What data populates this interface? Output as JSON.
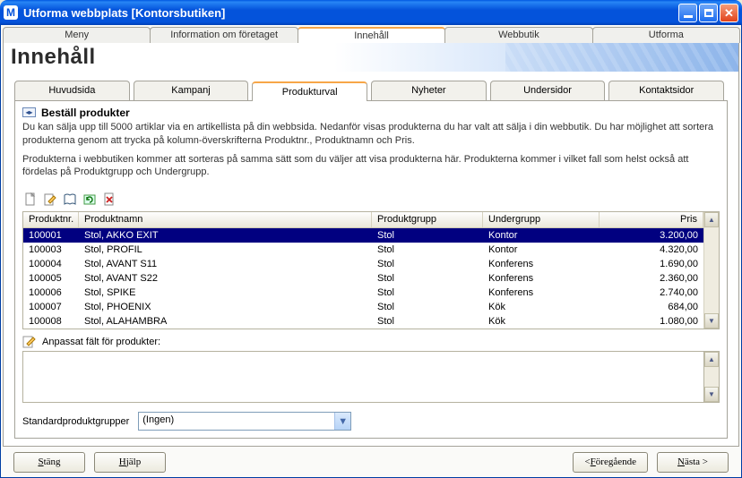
{
  "window": {
    "title": "Utforma webbplats [Kontorsbutiken]",
    "app_icon_letter": "M"
  },
  "main_tabs": {
    "items": [
      "Meny",
      "Information om företaget",
      "Innehåll",
      "Webbutik",
      "Utforma"
    ],
    "active_index": 2
  },
  "banner": {
    "heading": "Innehåll"
  },
  "sub_tabs": {
    "items": [
      "Huvudsida",
      "Kampanj",
      "Produkturval",
      "Nyheter",
      "Undersidor",
      "Kontaktsidor"
    ],
    "active_index": 2
  },
  "section": {
    "title": "Beställ produkter",
    "para1": "Du kan sälja upp till 5000 artiklar via en artikellista på din webbsida. Nedanför visas produkterna du har valt att sälja i din webbutik. Du har möjlighet att sortera produkterna genom att trycka på kolumn-överskrifterna Produktnr., Produktnamn och Pris.",
    "para2": "Produkterna i webbutiken kommer att sorteras på samma sätt som du väljer att visa produkterna här. Produkterna kommer i vilket fall som helst också att fördelas på Produktgrupp och Undergrupp."
  },
  "table": {
    "columns": [
      "Produktnr.",
      "Produktnamn",
      "Produktgrupp",
      "Undergrupp",
      "Pris"
    ],
    "rows": [
      {
        "nr": "100001",
        "namn": "Stol, AKKO EXIT",
        "grupp": "Stol",
        "under": "Kontor",
        "pris": "3.200,00",
        "selected": true
      },
      {
        "nr": "100003",
        "namn": "Stol, PROFIL",
        "grupp": "Stol",
        "under": "Kontor",
        "pris": "4.320,00"
      },
      {
        "nr": "100004",
        "namn": "Stol, AVANT S11",
        "grupp": "Stol",
        "under": "Konferens",
        "pris": "1.690,00"
      },
      {
        "nr": "100005",
        "namn": "Stol, AVANT S22",
        "grupp": "Stol",
        "under": "Konferens",
        "pris": "2.360,00"
      },
      {
        "nr": "100006",
        "namn": "Stol, SPIKE",
        "grupp": "Stol",
        "under": "Konferens",
        "pris": "2.740,00"
      },
      {
        "nr": "100007",
        "namn": "Stol, PHOENIX",
        "grupp": "Stol",
        "under": "Kök",
        "pris": "684,00"
      },
      {
        "nr": "100008",
        "namn": "Stol, ALAHAMBRA",
        "grupp": "Stol",
        "under": "Kök",
        "pris": "1.080,00"
      }
    ]
  },
  "custom_field": {
    "label": "Anpassat fält för produkter:"
  },
  "combo": {
    "label": "Standardproduktgrupper",
    "value": "(Ingen)"
  },
  "footer": {
    "close": "Stäng",
    "help": "Hjälp",
    "prev": "< Föregående",
    "next": "Nästa >"
  }
}
